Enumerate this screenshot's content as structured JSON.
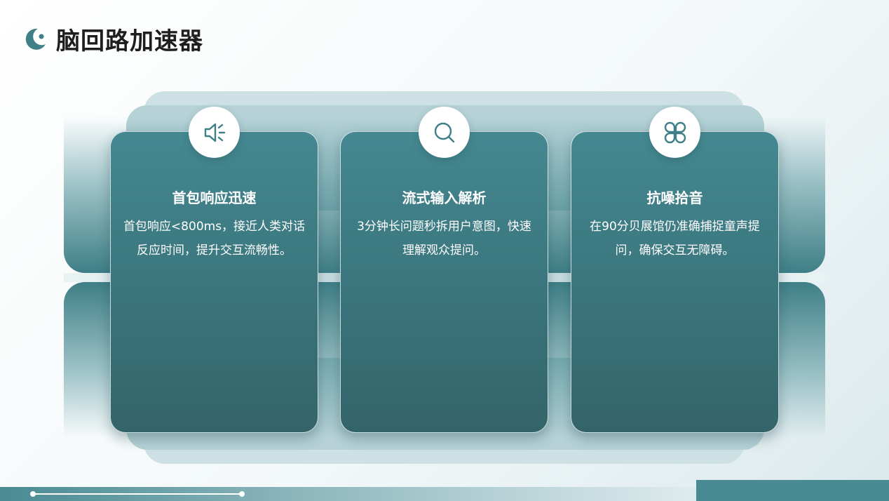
{
  "header": {
    "title": "脑回路加速器"
  },
  "cards": [
    {
      "icon": "speaker-icon",
      "title": "首包响应迅速",
      "description": "首包响应<800ms，接近人类对话反应时间，提升交互流畅性。"
    },
    {
      "icon": "search-icon",
      "title": "流式输入解析",
      "description": "3分钟长问题秒拆用户意图，快速理解观众提问。"
    },
    {
      "icon": "grid-petals-icon",
      "title": "抗噪拾音",
      "description": "在90分贝展馆仍准确捕捉童声提问，确保交互无障碍。"
    }
  ],
  "colors": {
    "accent": "#458891",
    "accent_dark": "#336469",
    "text_dark": "#1e1e1e"
  }
}
